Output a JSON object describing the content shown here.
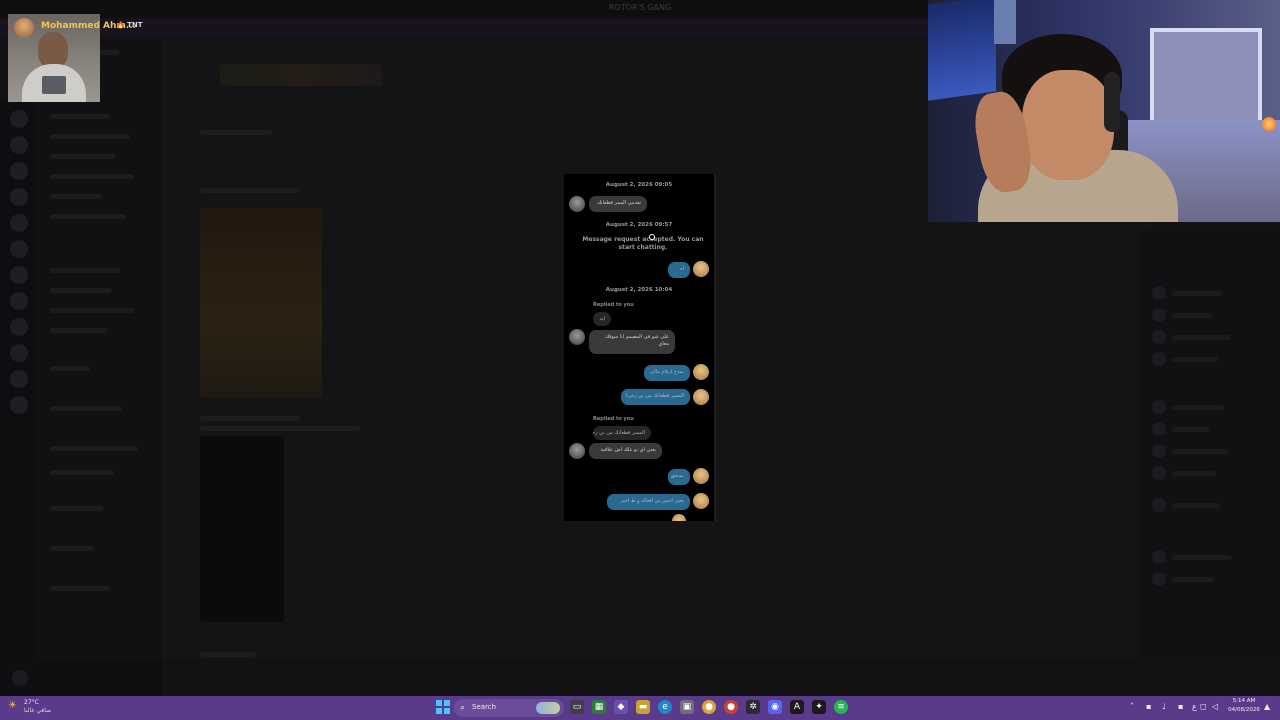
{
  "window": {
    "title": "ROTOR'S GANG"
  },
  "presenter": {
    "name": "Mohammed Ahm...",
    "badge": "🔥 TNT"
  },
  "phone": {
    "dates": [
      "August 2, 2026 09:05",
      "August 2, 2026 09:57",
      "August 2, 2026 10:04"
    ],
    "system_message": "Message request accepted. You can start chatting.",
    "replied_label": "Replied to you",
    "messages": [
      {
        "side": "in",
        "text": "تقدمي الممر قطعانك"
      },
      {
        "side": "out",
        "text": "اه"
      },
      {
        "side": "quote",
        "text": "ايه"
      },
      {
        "side": "in",
        "text": "على شو فى المصمم انا سوقك معاي"
      },
      {
        "side": "out",
        "text": "بمدح ارقام مالي"
      },
      {
        "side": "out",
        "text": "المسر قطعانك من بي زجرنا"
      },
      {
        "side": "quote",
        "text": "المسر قطعانك من بي زجرنا"
      },
      {
        "side": "in",
        "text": "يعني اي نو علك اش علاقية"
      },
      {
        "side": "out",
        "text": "بسحق"
      },
      {
        "side": "out",
        "text": "يعني احمن بي اقعاله و ط اخبر"
      }
    ]
  },
  "taskbar": {
    "weather_temp": "27°C",
    "weather_desc": "صافي غالبا",
    "search_label": "Search",
    "clock_time": "5:14 AM",
    "clock_date": "04/08/2026",
    "tray_lang": "ع"
  },
  "icons": {
    "weather": "sun-icon",
    "search": "search-icon",
    "start": "windows-start-icon"
  }
}
